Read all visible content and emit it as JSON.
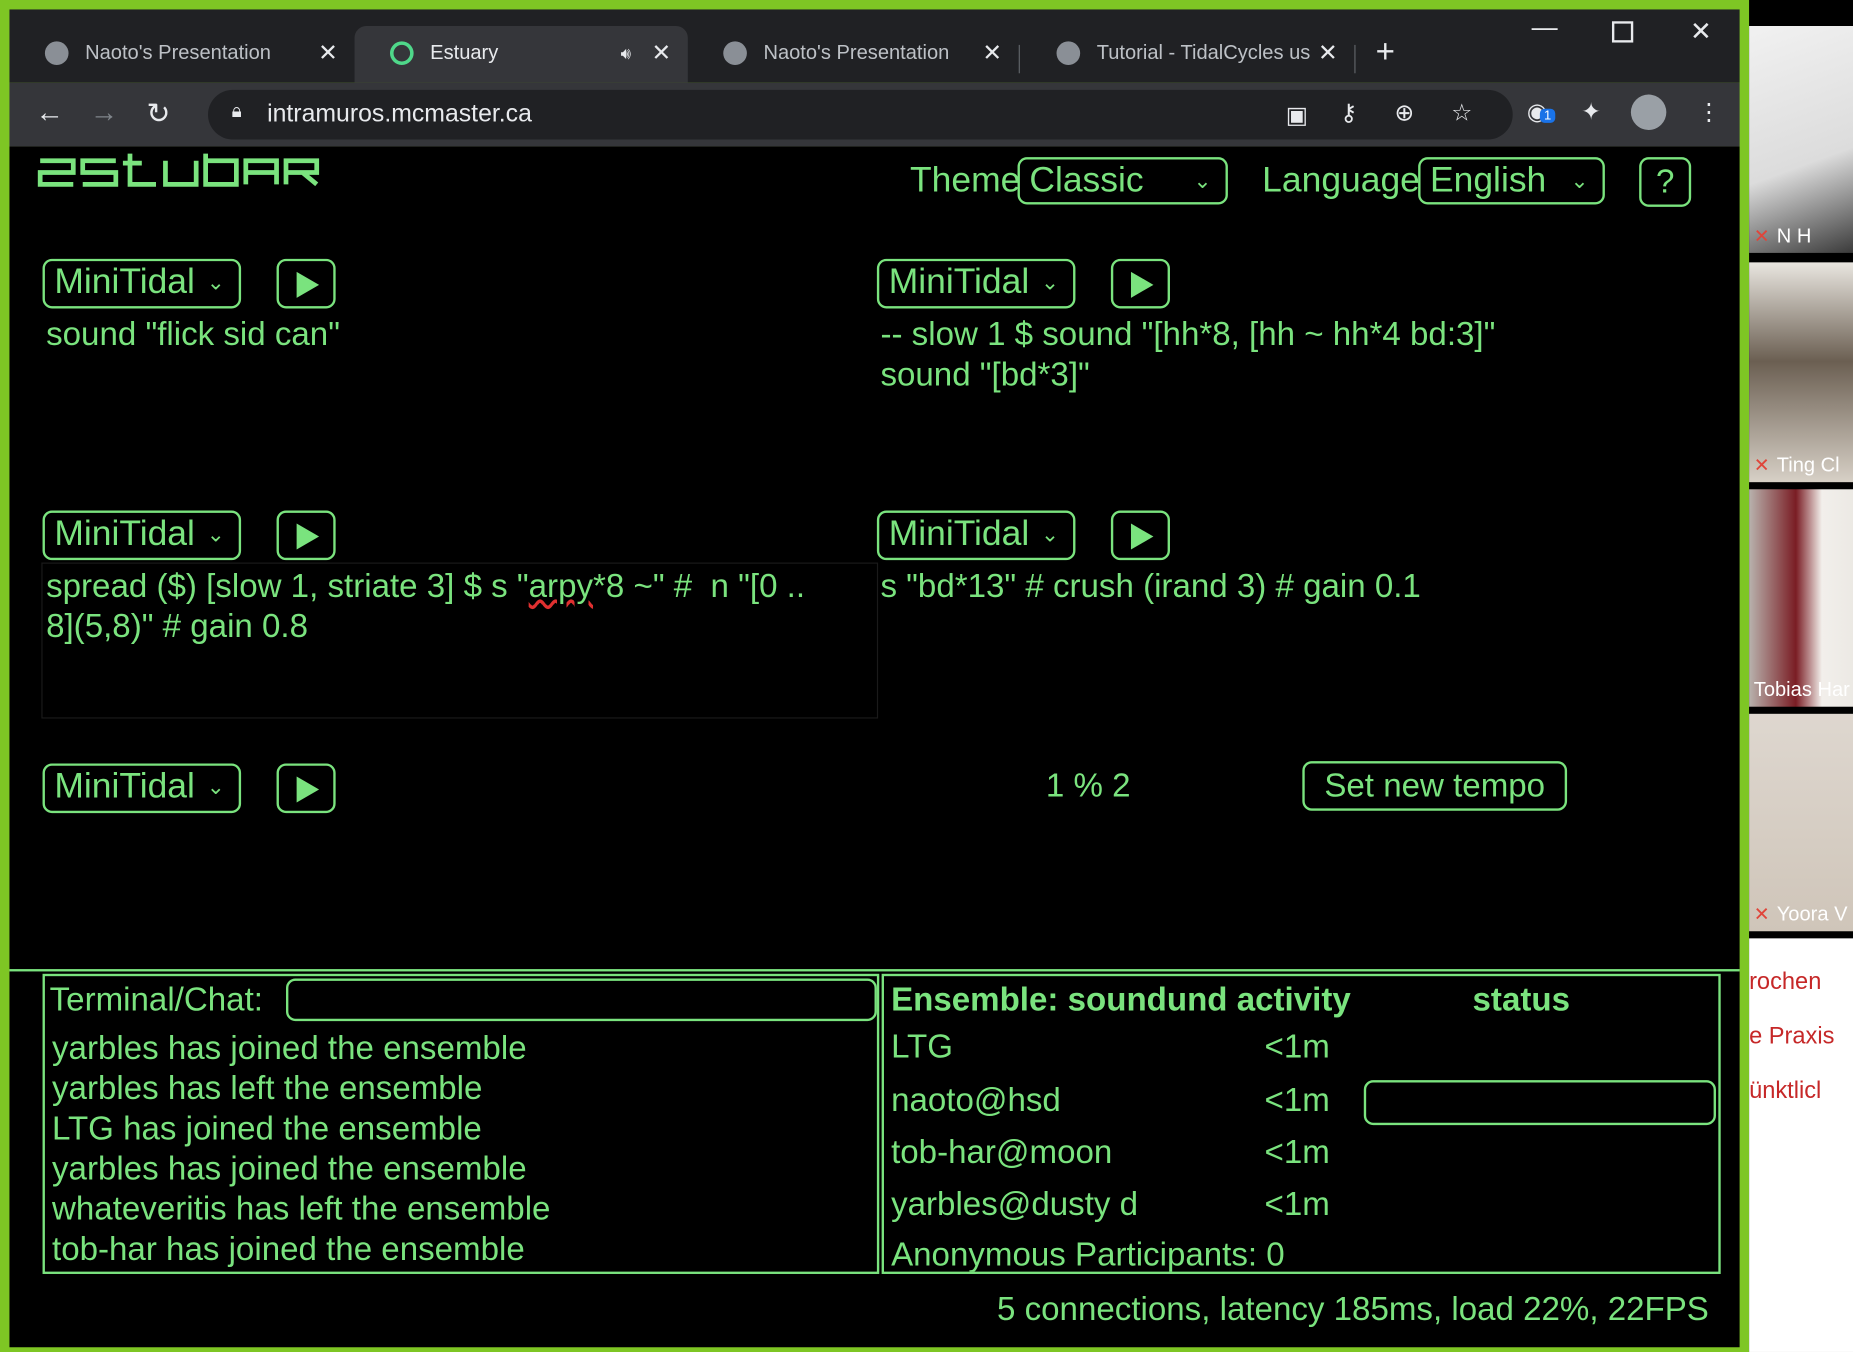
{
  "browser": {
    "tabs": [
      {
        "title": "Naoto's Presentation",
        "active": false
      },
      {
        "title": "Estuary",
        "active": true
      },
      {
        "title": "Naoto's Presentation",
        "active": false
      },
      {
        "title": "Tutorial - TidalCycles us",
        "active": false
      }
    ],
    "url": "intramuros.mcmaster.ca",
    "extension_badge": "1"
  },
  "estuary": {
    "header": {
      "theme_label": "Theme",
      "theme_value": "Classic",
      "language_label": "Language",
      "language_value": "English",
      "help_label": "?"
    },
    "editors": [
      {
        "language": "MiniTidal",
        "code": "sound \"flick sid can\""
      },
      {
        "language": "MiniTidal",
        "code": "-- slow 1 $ sound \"[hh*8, [hh ~ hh*4 bd:3]\"\nsound \"[bd*3]\""
      },
      {
        "language": "MiniTidal",
        "code_before": "spread ($) [slow 1, striate 3] $ s \"",
        "code_misspelled": "arpy",
        "code_after": "*8 ~\" #  n \"[0 ..\n8](5,8)\" # gain 0.8"
      },
      {
        "language": "MiniTidal",
        "code": "s \"bd*13\" # crush (irand 3) # gain 0.1"
      },
      {
        "language": "MiniTidal",
        "code": ""
      }
    ],
    "tempo": {
      "value": "1 % 2",
      "button_label": "Set new tempo"
    },
    "terminal": {
      "label": "Terminal/Chat:",
      "input_value": "",
      "messages": [
        "yarbles has joined the ensemble",
        "yarbles has left the ensemble",
        "LTG has joined the ensemble",
        "yarbles has joined the ensemble",
        "whateveritis has left the ensemble",
        "tob-har has joined the ensemble"
      ]
    },
    "ensemble": {
      "title": "Ensemble: soundund activity",
      "status_header": "status",
      "participants": [
        {
          "name": "LTG",
          "activity": "<1m"
        },
        {
          "name": "naoto@hsd",
          "activity": "<1m"
        },
        {
          "name": "tob-har@moon",
          "activity": "<1m"
        },
        {
          "name": "yarbles@dusty d",
          "activity": "<1m"
        }
      ],
      "anonymous": "Anonymous Participants: 0"
    },
    "footer": "5 connections, latency 185ms, load 22%, 22FPS"
  },
  "zoom": {
    "participants": [
      "N H",
      "Ting Cl",
      "Tobias Har",
      "Yoora V"
    ],
    "chat_fragments": [
      "rochen",
      "e Praxis",
      "ünktlicl"
    ]
  },
  "colors": {
    "estuary_green": "#7ae37e",
    "frame_green": "#7ec624",
    "page_bg": "#000000",
    "chrome_dark": "#202124",
    "chrome_mid": "#35363a"
  }
}
